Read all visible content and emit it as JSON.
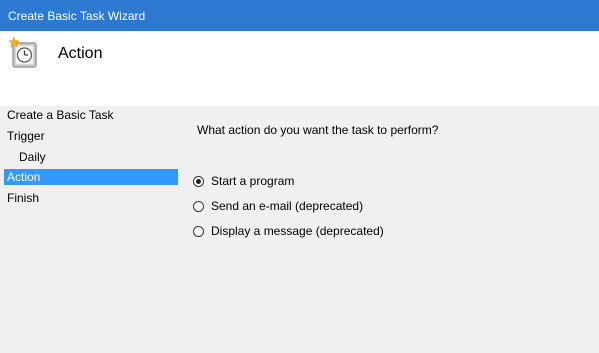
{
  "window": {
    "title": "Create Basic Task Wizard"
  },
  "header": {
    "title": "Action",
    "icon": "task-scheduler-clock-icon"
  },
  "sidebar": {
    "items": [
      {
        "label": "Create a Basic Task",
        "selected": false,
        "indent": false
      },
      {
        "label": "Trigger",
        "selected": false,
        "indent": false
      },
      {
        "label": "Daily",
        "selected": false,
        "indent": true
      },
      {
        "label": "Action",
        "selected": true,
        "indent": false
      },
      {
        "label": "Finish",
        "selected": false,
        "indent": false
      }
    ]
  },
  "main": {
    "question": "What action do you want the task to perform?",
    "options": [
      {
        "label": "Start a program",
        "checked": true
      },
      {
        "label": "Send an e-mail (deprecated)",
        "checked": false
      },
      {
        "label": "Display a message (deprecated)",
        "checked": false
      }
    ]
  },
  "colors": {
    "titlebar": "#2b79d1",
    "selection": "#3399ff",
    "background": "#f0f0f0"
  }
}
